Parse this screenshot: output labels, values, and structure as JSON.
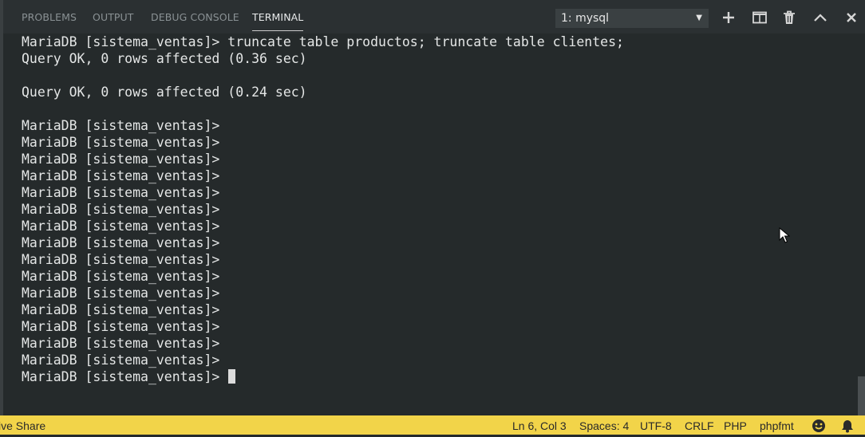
{
  "panel": {
    "tabs": [
      {
        "label": "PROBLEMS",
        "active": false
      },
      {
        "label": "OUTPUT",
        "active": false
      },
      {
        "label": "DEBUG CONSOLE",
        "active": false
      },
      {
        "label": "TERMINAL",
        "active": true
      }
    ],
    "terminal_select": "1: mysql",
    "actions": [
      "plus-icon",
      "split-icon",
      "trash-icon",
      "chevron-up-icon",
      "close-icon"
    ]
  },
  "terminal": {
    "lines": [
      "",
      "MariaDB [sistema_ventas]> truncate table productos; truncate table clientes;",
      "Query OK, 0 rows affected (0.36 sec)",
      "",
      "Query OK, 0 rows affected (0.24 sec)",
      "",
      "MariaDB [sistema_ventas]>",
      "MariaDB [sistema_ventas]>",
      "MariaDB [sistema_ventas]>",
      "MariaDB [sistema_ventas]>",
      "MariaDB [sistema_ventas]>",
      "MariaDB [sistema_ventas]>",
      "MariaDB [sistema_ventas]>",
      "MariaDB [sistema_ventas]>",
      "MariaDB [sistema_ventas]>",
      "MariaDB [sistema_ventas]>",
      "MariaDB [sistema_ventas]>",
      "MariaDB [sistema_ventas]>",
      "MariaDB [sistema_ventas]>",
      "MariaDB [sistema_ventas]>",
      "MariaDB [sistema_ventas]>",
      "MariaDB [sistema_ventas]> "
    ]
  },
  "status_bar": {
    "live_share": "ive Share",
    "position": "Ln 6, Col 3",
    "spaces": "Spaces: 4",
    "encoding": "UTF-8",
    "eol": "CRLF",
    "language": "PHP",
    "formatter": "phpfmt",
    "icons": [
      "smiley-icon",
      "bell-icon"
    ]
  },
  "colors": {
    "terminal_bg": "#252a2b",
    "status_bar_bg": "#f2d449",
    "text": "#e4e6e6"
  }
}
